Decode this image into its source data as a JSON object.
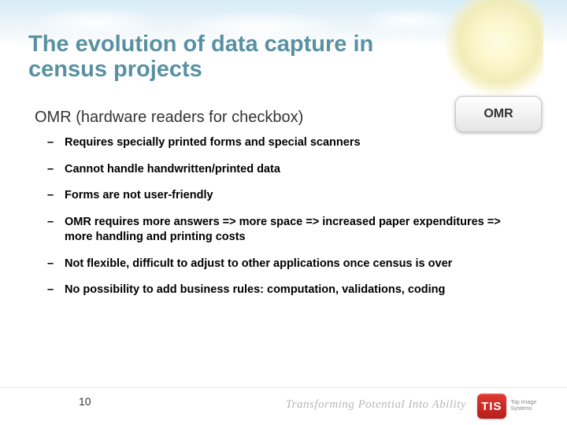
{
  "title": "The evolution of data capture in census projects",
  "subtitle": "OMR (hardware readers for checkbox)",
  "badge": {
    "label": "OMR"
  },
  "bullets": [
    "Requires specially printed forms and special scanners",
    "Cannot handle handwritten/printed data",
    "Forms are not user-friendly",
    "OMR requires more answers => more space => increased paper expenditures => more handling and printing costs",
    "Not flexible, difficult to adjust to other applications once census is over",
    "No possibility to add business rules: computation, validations, coding"
  ],
  "page_number": "10",
  "footer": {
    "tagline": "Transforming Potential Into Ability",
    "logo_text": "TIS",
    "logo_name": "Top Image Systems"
  }
}
